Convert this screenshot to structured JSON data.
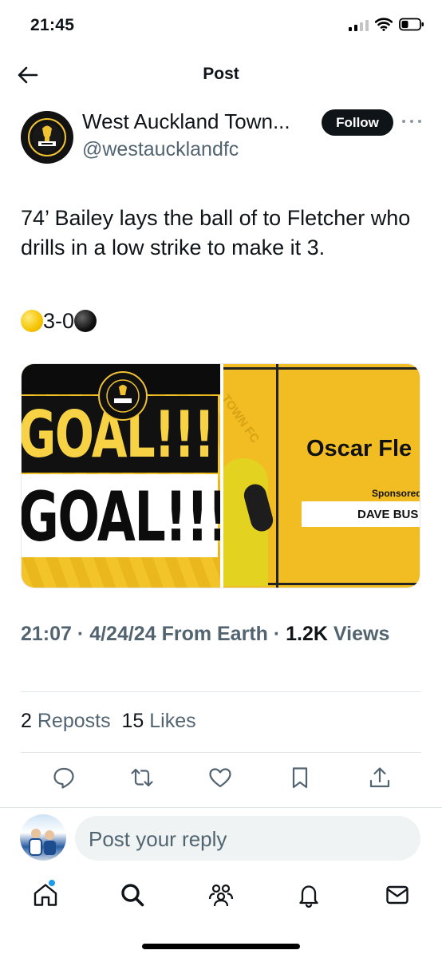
{
  "status_bar": {
    "time": "21:45",
    "icons": [
      "cellular-signal-icon",
      "wifi-icon",
      "battery-icon"
    ]
  },
  "nav": {
    "back_icon": "arrow-left-icon",
    "title": "Post"
  },
  "author": {
    "display_name": "West Auckland Town...",
    "handle": "@westaucklandfc",
    "follow_label": "Follow"
  },
  "tweet": {
    "text": "74’ Bailey lays the ball of to Fletcher who drills in a low strike to make it 3.",
    "score": "3-0"
  },
  "media": {
    "image1": {
      "goal_line_1": "GOAL!!!",
      "goal_line_2": "GOAL!!!"
    },
    "image2": {
      "watermark": "TOWN FC",
      "player_name": "Oscar Fle",
      "sponsored_label": "Sponsored",
      "sponsor_name": "DAVE BUS"
    }
  },
  "meta": {
    "time": "21:07",
    "separator": "·",
    "date": "4/24/24",
    "source": "From Earth",
    "views_count": "1.2K",
    "views_label": "Views"
  },
  "stats": {
    "reposts_count": "2",
    "reposts_label": "Reposts",
    "likes_count": "15",
    "likes_label": "Likes"
  },
  "actions": [
    "reply-icon",
    "repost-icon",
    "like-icon",
    "bookmark-icon",
    "share-icon"
  ],
  "reply": {
    "placeholder": "Post your reply"
  },
  "tabbar": {
    "items": [
      "home-icon",
      "search-icon",
      "communities-icon",
      "notifications-icon",
      "messages-icon"
    ]
  },
  "colors": {
    "text": "#0f1419",
    "secondary": "#536471",
    "accent": "#1d9bf0",
    "goal_yellow": "#f2bd23"
  }
}
